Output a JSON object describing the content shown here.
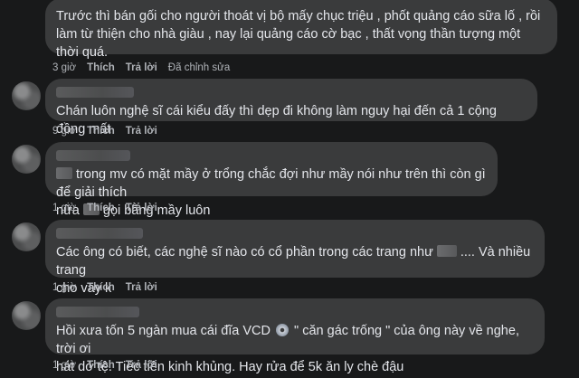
{
  "comments": [
    {
      "text": "Trước thì bán gối cho người thoát vị bộ mấy chục triệu , phốt quảng cáo sữa lố , rồi làm từ thiện cho nhà giàu , nay lại quảng cáo cờ bạc , thất vọng thần tượng một thời quá.",
      "time": "3 giờ",
      "like": "Thích",
      "reply": "Trả lời",
      "edited": "Đã chỉnh sửa"
    },
    {
      "text": "Chán luôn nghệ sĩ cái kiểu đấy thì dẹp đi không làm nguy hại đến cả 1 cộng đồng mất",
      "time": "9 giờ",
      "like": "Thích",
      "reply": "Trả lời"
    },
    {
      "text_a": " trong mv có mặt mầy ở trổng chắc đợi như mầy nói như trên thì còn gì để giải thích",
      "text_b": "nữa ",
      "text_c": " gọi bằng mầy luôn",
      "time": "1 giờ",
      "like": "Thích",
      "reply": "Trả lời"
    },
    {
      "text_a": "Các ông có biết, các nghệ sĩ nào có cổ phần trong các trang như ",
      "text_b": " .... Và nhiều trang",
      "text_c": "cho vay k",
      "time": "1 giờ",
      "like": "Thích",
      "reply": "Trả lời"
    },
    {
      "text_a": "Hồi xưa tốn 5 ngàn mua cái đĩa VCD ",
      "text_b": " \" căn gác trống \" của ông này về nghe, trời ơi",
      "text_c": "hát dở tệ. Tiếc tiền kinh khủng. Hay rửa để 5k ăn ly chè đậu",
      "time": "1 giờ",
      "like": "Thích",
      "reply": "Trả lời"
    }
  ]
}
